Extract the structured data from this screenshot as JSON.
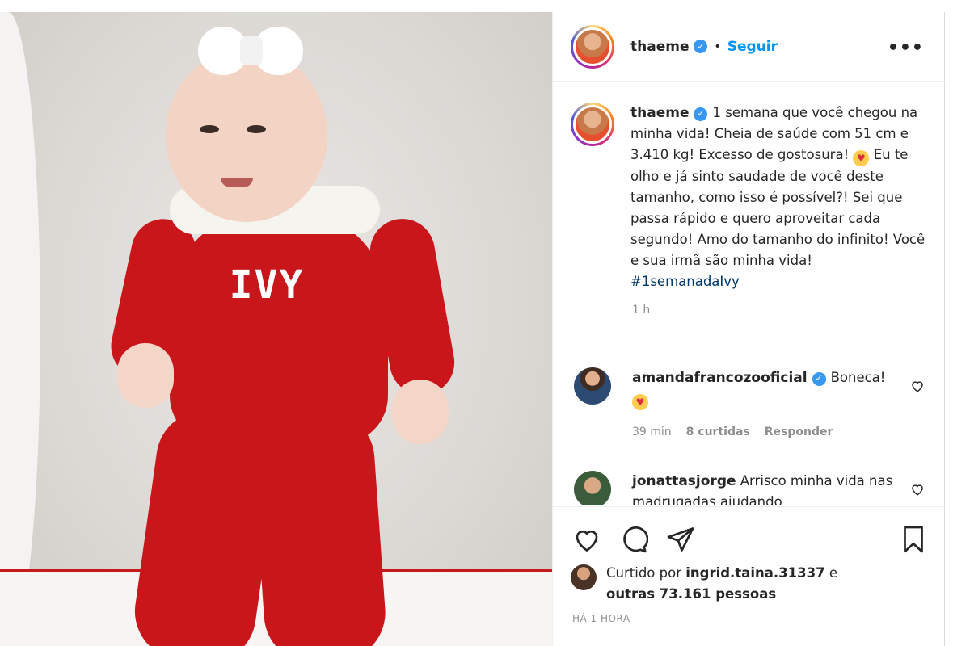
{
  "photo": {
    "knit_name": "IVY",
    "alt_subject": "baby-photo"
  },
  "post": {
    "username": "thaeme",
    "dot": "•",
    "follow_label": "Seguir",
    "more_label": "•••"
  },
  "caption": {
    "username": "thaeme",
    "text": "1 semana que você chegou na minha vida! Cheia de saúde com 51 cm e 3.410 kg! Excesso de gostosura!",
    "text_after_emoji": "Eu te olho e já sinto saudade de você deste tamanho, como isso é possível?! Sei que passa rápido e quero aproveitar cada segundo! Amo do tamanho do infinito! Você e sua irmã são minha vida!",
    "hashtag": "#1semanadaIvy",
    "time": "1 h"
  },
  "comments": [
    {
      "username": "amandafrancozooficial",
      "text": "Boneca!",
      "time": "39 min",
      "likes": "8 curtidas",
      "reply": "Responder"
    },
    {
      "username": "jonattasjorge",
      "text": "Arrisco minha vida nas madrugadas ajudando"
    }
  ],
  "likes": {
    "prefix": "Curtido por",
    "user": "ingrid.taina.31337",
    "connector": "e",
    "others": "outras 73.161 pessoas"
  },
  "timestamp": "HÁ 1 HORA",
  "colors": {
    "accent_blue": "#0095f6",
    "verified_blue": "#3897f0",
    "onesie_red": "#c8161b",
    "hashtag_blue": "#00376b",
    "muted_gray": "#8e8e8e"
  },
  "icons": {
    "heart": "heart-icon",
    "comment": "comment-icon",
    "share": "share-icon",
    "save": "bookmark-icon",
    "verified": "verified-badge-icon",
    "more": "more-options-icon"
  }
}
